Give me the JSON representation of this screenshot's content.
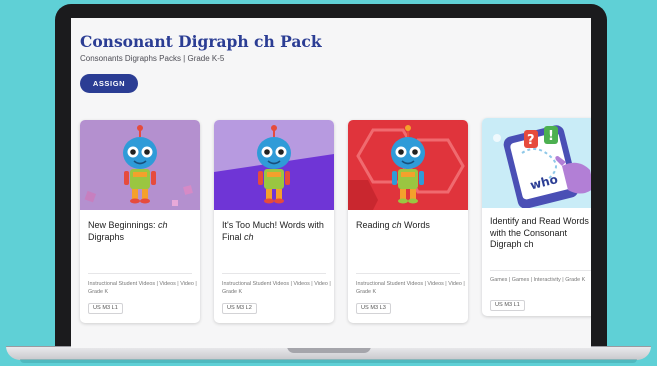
{
  "colors": {
    "background": "#5fd0d6",
    "brand": "#2b3d94",
    "laptop": "#1b1b1d"
  },
  "header": {
    "title": "Consonant Digraph ch Pack",
    "subtitle": "Consonants Digraphs Packs | Grade K-5",
    "assign_label": "ASSIGN"
  },
  "cards": [
    {
      "title_before": "New Beginnings: ",
      "title_em": "ch",
      "title_after": " Digraphs",
      "meta": "Instructional Student Videos | Videos | Video | Grade K",
      "code": "US M3 L1",
      "thumbnail_icon": "robot-character-icon"
    },
    {
      "title_before": "It's Too Much! Words with Final ",
      "title_em": "ch",
      "title_after": "",
      "meta": "Instructional Student Videos | Videos | Video | Grade K",
      "code": "US M3 L2",
      "thumbnail_icon": "robot-character-icon"
    },
    {
      "title_before": "Reading ",
      "title_em": "ch",
      "title_after": " Words",
      "meta": "Instructional Student Videos | Videos | Video | Grade K",
      "code": "US M3 L3",
      "thumbnail_icon": "robot-character-icon"
    },
    {
      "title_before": "Identify and Read Words with the Consonant Digraph ch",
      "title_em": "",
      "title_after": "",
      "meta": "Games | Games | Interactivity | Grade K",
      "code": "US M3 L1",
      "thumbnail_icon": "tablet-game-icon",
      "thumb_word": "who"
    }
  ]
}
